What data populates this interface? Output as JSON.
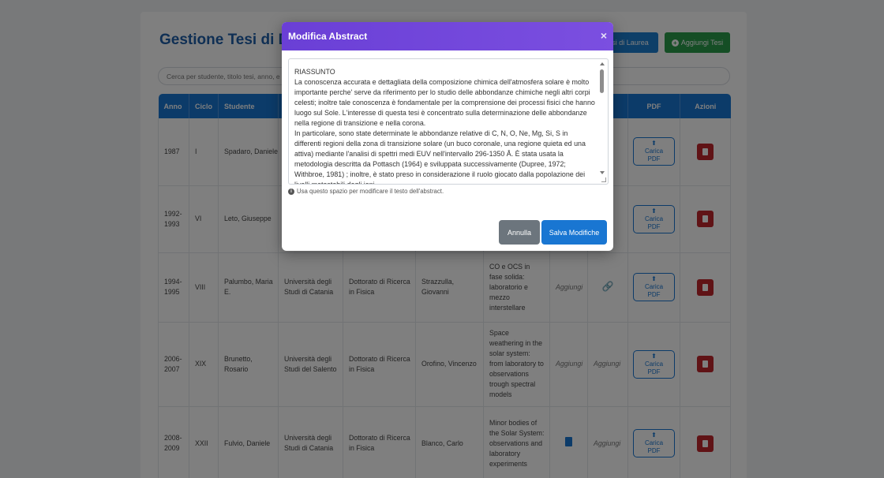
{
  "header": {
    "title": "Gestione Tesi di Do",
    "btn_lauree": "esi di Laurea",
    "btn_add": "Aggiungi Tesi"
  },
  "search": {
    "placeholder": "Cerca per studente, titolo tesi, anno, e"
  },
  "table": {
    "columns": {
      "anno": "Anno",
      "ciclo": "Ciclo",
      "studente": "Studente",
      "abstract": "",
      "pdf": "PDF",
      "azioni": "Azioni"
    },
    "rows": [
      {
        "anno": "1987",
        "ciclo": "I",
        "studente": "Spadaro, Daniele",
        "universita": "",
        "dottorato": "",
        "tutor": "",
        "titolo": "",
        "abstract": "",
        "link": "link-icon"
      },
      {
        "anno": "1992-\n1993",
        "ciclo": "VI",
        "studente": "Leto, Giuseppe",
        "universita": "",
        "dottorato": "",
        "tutor": "",
        "titolo": "",
        "abstract": "",
        "link": "link-icon"
      },
      {
        "anno": "1994-\n1995",
        "ciclo": "VIII",
        "studente": "Palumbo, Maria\nE.",
        "universita": "Università degli\nStudi di Catania",
        "dottorato": "Dottorato di Ricerca\nin Fisica",
        "tutor": "Strazzulla,\nGiovanni",
        "titolo": "CO e OCS in\nfase solida:\nlaboratorio e\nmezzo\ninterstellare",
        "abstract": "Aggiungi",
        "link": "link-icon"
      },
      {
        "anno": "2006-\n2007",
        "ciclo": "XIX",
        "studente": "Brunetto, Rosario",
        "universita": "Università degli\nStudi del Salento",
        "dottorato": "Dottorato di Ricerca\nin Fisica",
        "tutor": "Orofino, Vincenzo",
        "titolo": "Space\nweathering in the\nsolar system:\nfrom laboratory to\nobservations\ntrough spectral\nmodels",
        "abstract": "Aggiungi",
        "link": "Aggiungi"
      },
      {
        "anno": "2008-\n2009",
        "ciclo": "XXII",
        "studente": "Fulvio, Daniele",
        "universita": "Università degli\nStudi di Catania",
        "dottorato": "Dottorato di Ricerca\nin Fisica",
        "tutor": "Blanco, Carlo",
        "titolo": "Minor bodies of\nthe Solar System:\nobservations and\nlaboratory\nexperiments",
        "abstract": "file-icon",
        "link": "Aggiungi"
      }
    ],
    "pdf_button": "Carica\nPDF"
  },
  "modal": {
    "title": "Modifica Abstract",
    "close": "×",
    "abstract_text": [
      "RIASSUNTO",
      "La conoscenza accurata e dettagliata della composizione chimica dell'atmosfera solare è molto importante perche' serve da riferimento per lo studio delle abbondanze chimiche negli altri corpi celesti; inoltre tale conoscenza è fondamentale per la comprensione dei processi fisici che hanno luogo sul Sole. L'interesse di questa tesi è concentrato sulla determinazione delle abbondanze nella regione di transizione e nella corona.",
      "In particolare, sono state determinate le abbondanze relative di C, N, O, Ne, Mg, Si, S in differenti regioni della zona di transizione solare (un buco coronale, una regione quieta ed una attiva) mediante l'analisi di spettri medi EUV nell'intervallo 296-1350 Å. È stata usata la metodologia descritta da Pottasch (1964) e sviluppata successivamente (Dupree, 1972; Withbroe, 1981) ; inoltre, è stato preso in considerazione il ruolo giocato dalla popolazione dei livelli metastabili degli ioni"
    ],
    "hint": "Usa questo spazio per modificare il testo dell'abstract.",
    "cancel": "Annulla",
    "save": "Salva Modifiche"
  }
}
